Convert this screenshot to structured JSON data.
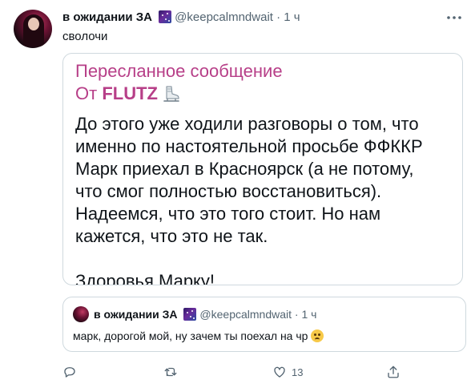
{
  "tweet": {
    "author_name": "в ожидании ЗА",
    "handle": "@keepcalmndwait",
    "separator": "·",
    "time": "1 ч",
    "text": "сволочи"
  },
  "forwarded": {
    "title": "Пересланное сообщение",
    "from_prefix": "От ",
    "from_name": "FLUTZ",
    "body": [
      "До этого уже ходили разговоры о том, что",
      "именно по настоятельной просьбе ФФККР",
      "Марк приехал в Красноярск (а не потому,",
      "что смог полностью восстановиться).",
      "Надеемся, что это того стоит. Но нам",
      "кажется, что это не так."
    ],
    "closing": "Здоровья Марку!"
  },
  "quoted": {
    "author_name": "в ожидании ЗА",
    "handle": "@keepcalmndwait",
    "separator": "·",
    "time": "1 ч",
    "text": "марк, дорогой мой, ну зачем ты поехал на чр"
  },
  "actions": {
    "reply_count": "",
    "retweet_count": "",
    "like_count": "13",
    "share_count": ""
  },
  "icons": {
    "more": "more-horizontal-icon",
    "reply": "reply-icon",
    "retweet": "retweet-icon",
    "like": "heart-icon",
    "share": "share-icon",
    "name_emoji": "milky-way-emoji",
    "forward_emoji": "ice-skate-emoji",
    "quote_emoji": "worried-face-emoji"
  },
  "colors": {
    "text": "#0f1419",
    "muted": "#536471",
    "forward_accent": "#b73f88",
    "border": "#cfd9de"
  }
}
